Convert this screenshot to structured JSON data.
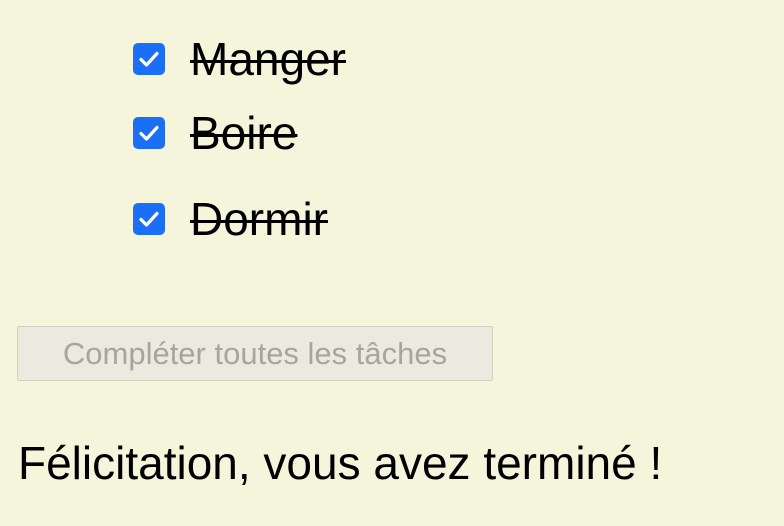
{
  "tasks": [
    {
      "label": "Manger",
      "checked": true
    },
    {
      "label": "Boire",
      "checked": true
    },
    {
      "label": "Dormir",
      "checked": true
    }
  ],
  "complete_all_button": {
    "label": "Compléter toutes les tâches",
    "disabled": true
  },
  "congrats_message": "Félicitation, vous avez terminé !",
  "colors": {
    "background": "#f5f5dc",
    "checkbox": "#1b6ff5",
    "button_text_disabled": "#a6a6a0"
  }
}
